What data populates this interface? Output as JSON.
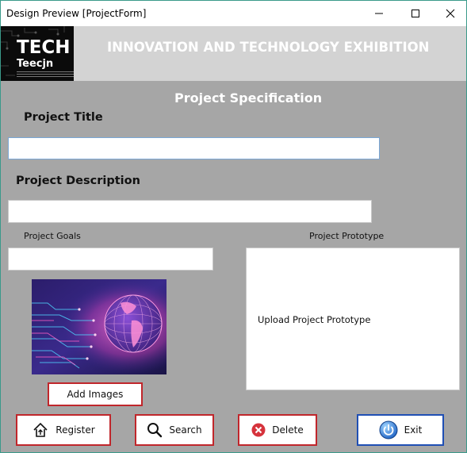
{
  "window": {
    "title": "Design Preview [ProjectForm]",
    "controls": [
      "minimize-icon",
      "maximize-icon",
      "close-icon"
    ]
  },
  "banner": {
    "logo_big": "TECH",
    "logo_small": "Teecjn",
    "heading": "INNOVATION AND TECHNOLOGY EXHIBITION"
  },
  "form": {
    "section_title": "Project Specification",
    "title_label": "Project Title",
    "title_value": "",
    "description_label": "Project Description",
    "description_value": "",
    "goals_label": "Project Goals",
    "goals_value": "",
    "prototype_label": "Project Prototype",
    "prototype_placeholder": "Upload Project Prototype",
    "add_images_label": "Add Images"
  },
  "actions": {
    "register": "Register",
    "search": "Search",
    "delete": "Delete",
    "exit": "Exit"
  },
  "colors": {
    "background": "#a6a6a6",
    "button_border": "#c0262b",
    "exit_border": "#1f4fb4",
    "banner": "#d3d3d3"
  }
}
